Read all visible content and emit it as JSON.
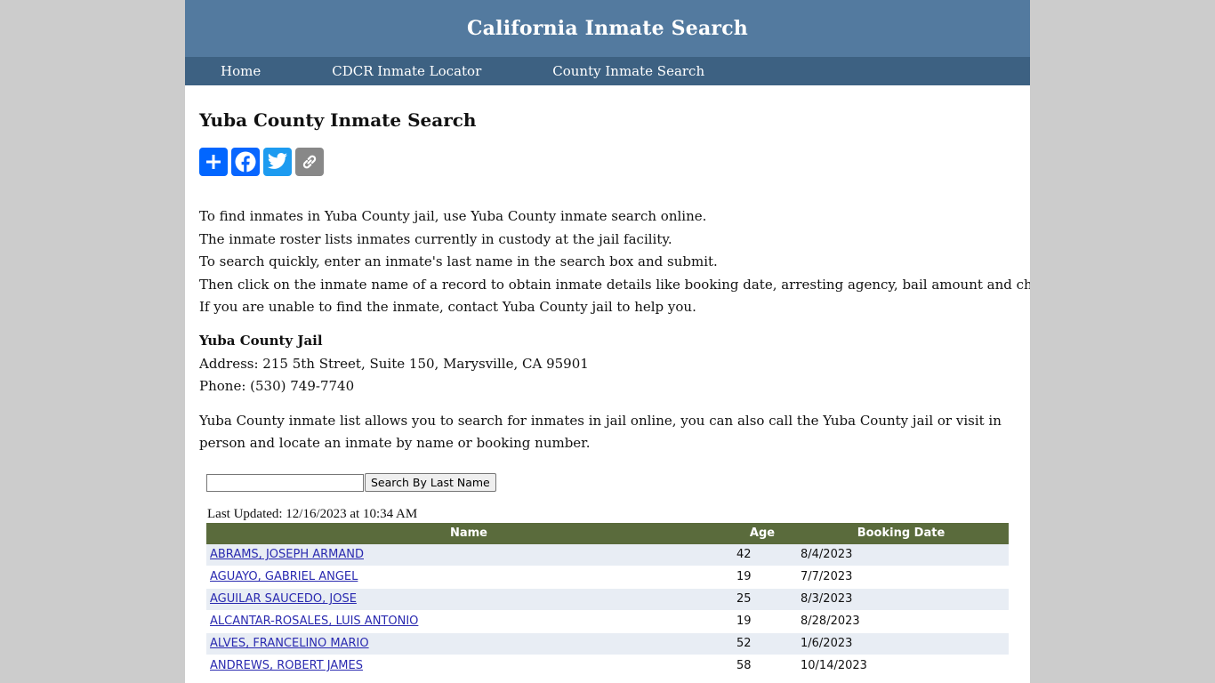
{
  "header": {
    "title": "California Inmate Search"
  },
  "nav": {
    "items": [
      {
        "label": "Home"
      },
      {
        "label": "CDCR Inmate Locator"
      },
      {
        "label": "County Inmate Search"
      }
    ]
  },
  "main": {
    "title": "Yuba County Inmate Search",
    "share_icons": [
      "share-add-icon",
      "facebook-icon",
      "twitter-icon",
      "copy-link-icon"
    ],
    "intro": [
      "To find inmates in Yuba County jail, use Yuba County inmate search online.",
      "The inmate roster lists inmates currently in custody at the jail facility.",
      "To search quickly, enter an inmate's last name in the search box and submit.",
      "Then click on the inmate name of a record to obtain inmate details like booking date, arresting agency, bail amount and charge.",
      "If you are unable to find the inmate, contact Yuba County jail to help you."
    ],
    "jail": {
      "name": "Yuba County Jail",
      "address": "Address: 215 5th Street, Suite 150, Marysville, CA 95901",
      "phone": "Phone: (530) 749-7740"
    },
    "description": "Yuba County inmate list allows you to search for inmates in jail online, you can also call the Yuba County jail or visit in person and locate an inmate by name or booking number."
  },
  "search": {
    "value": "",
    "button_label": "Search By Last Name"
  },
  "roster": {
    "last_updated": "Last Updated: 12/16/2023 at 10:34 AM",
    "columns": [
      "Name",
      "Age",
      "Booking Date"
    ],
    "rows": [
      {
        "name": "ABRAMS, JOSEPH ARMAND",
        "age": "42",
        "booking_date": "8/4/2023"
      },
      {
        "name": "AGUAYO, GABRIEL ANGEL",
        "age": "19",
        "booking_date": "7/7/2023"
      },
      {
        "name": "AGUILAR SAUCEDO, JOSE",
        "age": "25",
        "booking_date": "8/3/2023"
      },
      {
        "name": "ALCANTAR-ROSALES, LUIS ANTONIO",
        "age": "19",
        "booking_date": "8/28/2023"
      },
      {
        "name": "ALVES, FRANCELINO MARIO",
        "age": "52",
        "booking_date": "1/6/2023"
      },
      {
        "name": "ANDREWS, ROBERT JAMES",
        "age": "58",
        "booking_date": "10/14/2023"
      }
    ]
  },
  "colors": {
    "header_bg": "#537a9f",
    "nav_bg": "#3d6182",
    "table_header_bg": "#5a6b3c",
    "row_alt_bg": "#e8edf4",
    "page_bg": "#cccccc"
  }
}
